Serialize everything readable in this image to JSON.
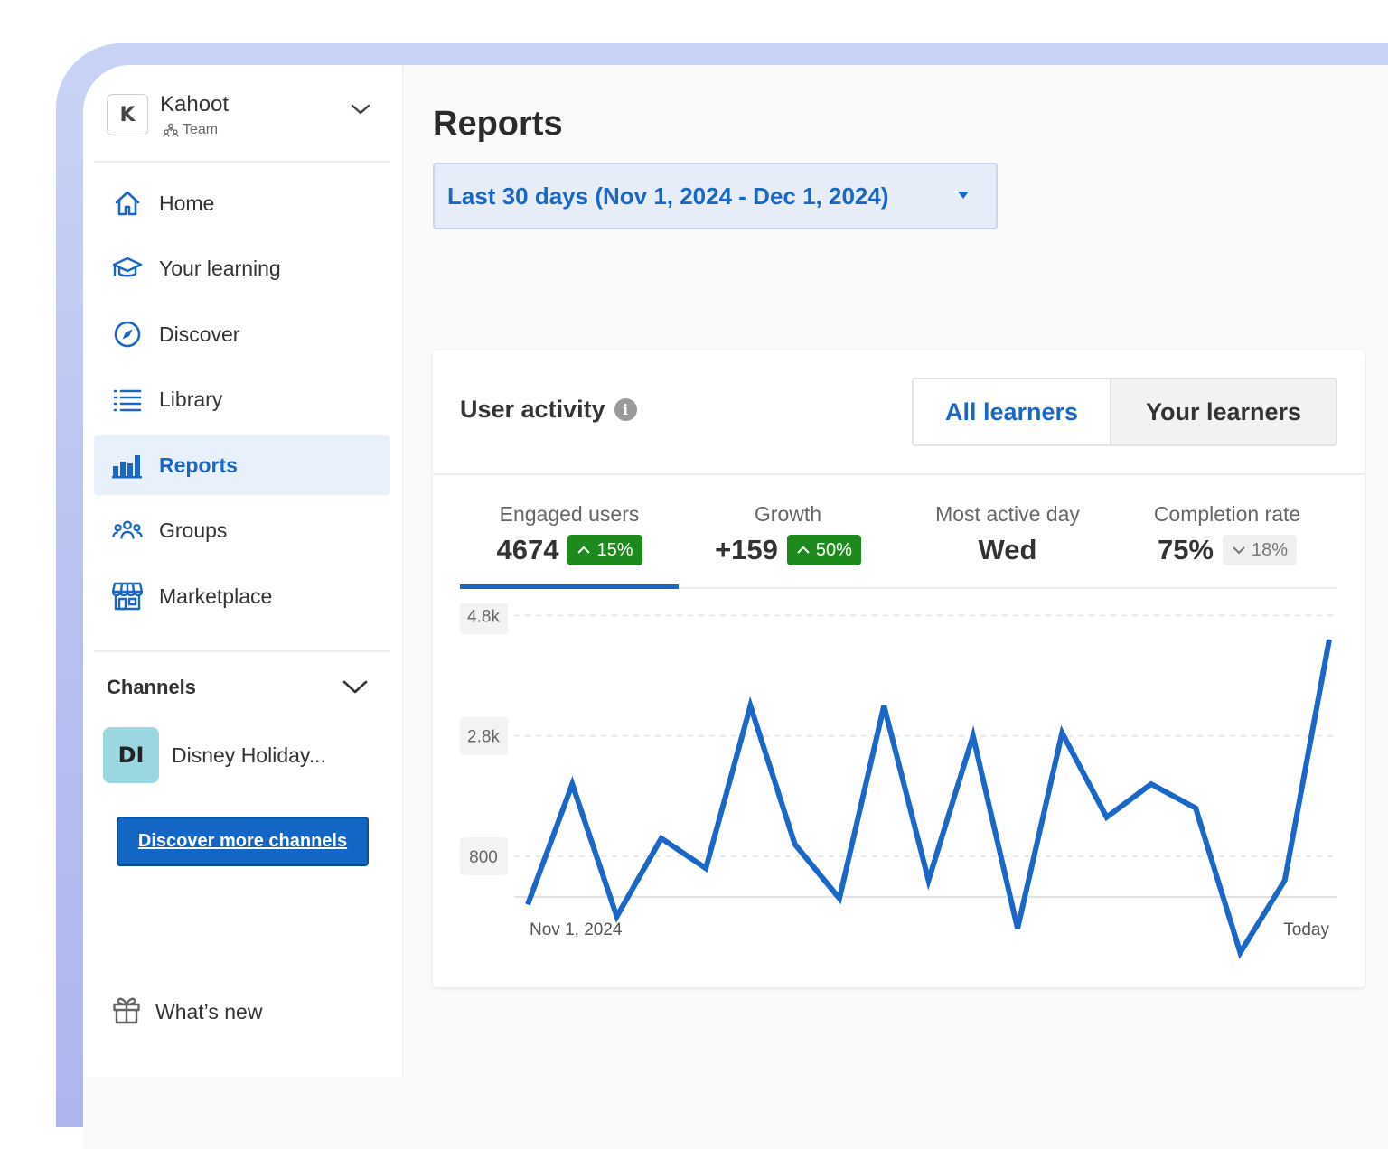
{
  "org": {
    "initial": "K",
    "name": "Kahoot",
    "subtitle": "Team"
  },
  "nav": {
    "items": [
      {
        "label": "Home",
        "icon": "home-icon"
      },
      {
        "label": "Your learning",
        "icon": "graduation-cap-icon"
      },
      {
        "label": "Discover",
        "icon": "compass-icon"
      },
      {
        "label": "Library",
        "icon": "list-icon"
      },
      {
        "label": "Reports",
        "icon": "bar-chart-icon",
        "active": true
      },
      {
        "label": "Groups",
        "icon": "people-icon"
      },
      {
        "label": "Marketplace",
        "icon": "store-icon"
      }
    ]
  },
  "channels": {
    "heading": "Channels",
    "items": [
      {
        "initials": "DI",
        "name": "Disney Holiday..."
      }
    ],
    "discover_label": "Discover more channels"
  },
  "whats_new": {
    "label": "What’s new",
    "icon": "gift-icon"
  },
  "page": {
    "title": "Reports",
    "range_label": "Last 30 days (Nov 1, 2024 - Dec 1, 2024)"
  },
  "activity": {
    "title": "User activity",
    "toggle": {
      "all": "All learners",
      "yours": "Your learners",
      "selected": "all"
    },
    "stats": [
      {
        "label": "Engaged users",
        "value": "4674",
        "badge": "15%",
        "trend": "up"
      },
      {
        "label": "Growth",
        "value": "+159",
        "badge": "50%",
        "trend": "up"
      },
      {
        "label": "Most active day",
        "value": "Wed"
      },
      {
        "label": "Completion rate",
        "value": "75%",
        "badge": "18%",
        "trend": "down"
      }
    ]
  },
  "colors": {
    "accent": "#1a67c8",
    "positive": "#1e8a1e",
    "channel_avatar": "#9bd7e0"
  },
  "chart_data": {
    "type": "line",
    "series": [
      {
        "values": [
          0,
          2000,
          -200,
          1100,
          600,
          3300,
          1000,
          100,
          3300,
          400,
          2800,
          -400,
          2850,
          1450,
          2000,
          1600,
          -800,
          400,
          4400
        ]
      }
    ],
    "y_ticks": [
      "4.8k",
      "2.8k",
      "800"
    ],
    "y_tick_values": [
      4800,
      2800,
      800
    ],
    "x_tick_labels": [
      "Nov 1, 2024",
      "Today"
    ],
    "ylim": [
      -1300,
      5000
    ],
    "grid": "horizontal dashed"
  }
}
